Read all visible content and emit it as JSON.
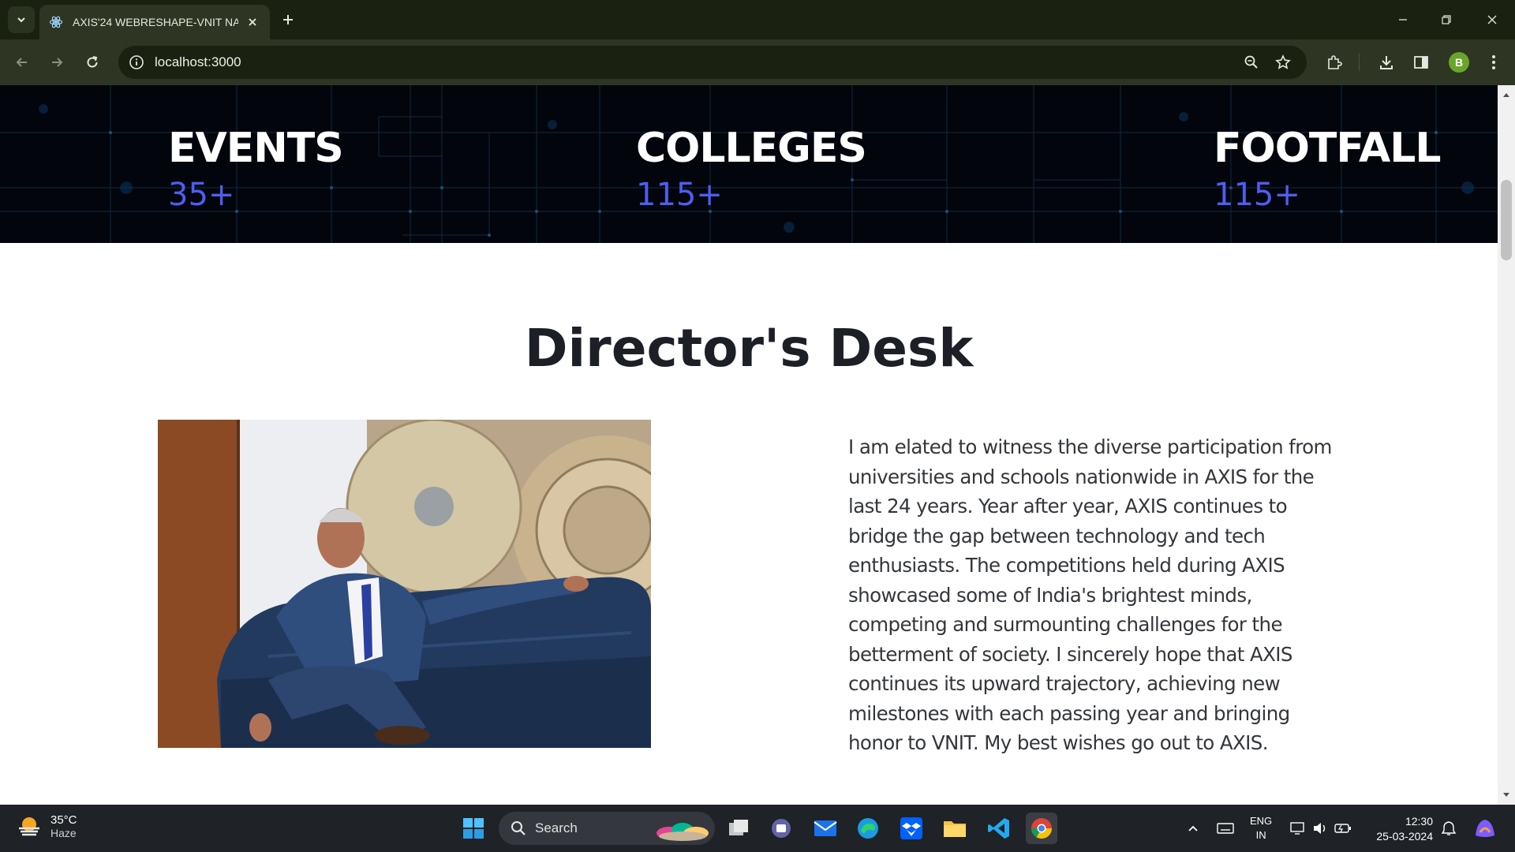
{
  "browser": {
    "tab_title": "AXIS'24 WEBRESHAPE-VNIT NA",
    "url": "localhost:3000",
    "profile_initial": "B"
  },
  "stats": [
    {
      "label": "EVENTS",
      "value": "35+"
    },
    {
      "label": "COLLEGES",
      "value": "115+"
    },
    {
      "label": "FOOTFALL",
      "value": "115+"
    }
  ],
  "directors_desk": {
    "title": "Director's Desk",
    "message": "I am elated to witness the diverse participation from universities and schools nationwide in AXIS for the last 24 years. Year after year, AXIS continues to bridge the gap between technology and tech enthusiasts. The competitions held during AXIS showcased some of India's brightest minds, competing and surmounting challenges for the betterment of society. I sincerely hope that AXIS continues its upward trajectory, achieving new milestones with each passing year and bringing honor to VNIT. My best wishes go out to AXIS."
  },
  "taskbar": {
    "weather_temp": "35°C",
    "weather_desc": "Haze",
    "search_label": "Search",
    "lang_line1": "ENG",
    "lang_line2": "IN",
    "time": "12:30",
    "date": "25-03-2024"
  },
  "colors": {
    "stat_value": "#4d5ef0",
    "stats_bg": "#02050c",
    "chrome_bg": "#2e3522"
  }
}
